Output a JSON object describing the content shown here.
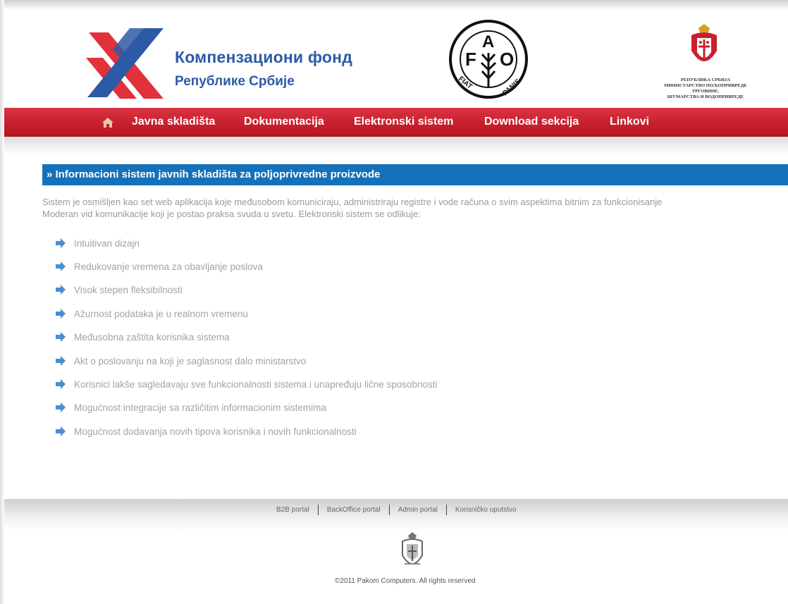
{
  "header": {
    "title": "Компензациони фонд",
    "subtitle": "Републике Србије",
    "ministry_lines": [
      "РЕПУБЛИКА СРБИЈА",
      "МИНИСТАРСТВО ПОЉОПРИВРЕДЕ",
      "ТРГОВИНЕ,",
      "ШУМАРСТВА И ВОДОПРИВРЕДЕ"
    ]
  },
  "nav": {
    "items": [
      "Javna skladišta",
      "Dokumentacija",
      "Elektronski sistem",
      "Download sekcija",
      "Linkovi"
    ]
  },
  "main": {
    "section_title": "» Informacioni sistem javnih skladišta za poljoprivredne proizvode",
    "intro_lines": [
      "Sistem je osmišljen kao set web aplikacija koje međusobom komuniciraju, administriraju registre i vode računa o svim aspektima bitnim za funkcionisanje",
      "Moderan vid komunikacije koji je postao praksa svuda u svetu. Elektronski sistem se odlikuje:"
    ],
    "features": [
      "Intuitivan dizajn",
      "Redukovanje vremena za obavljanje poslova",
      "Visok stepen fleksibilnosti",
      "Ažurnost podataka je u realnom vremenu",
      "Međusobna zaštita korisnika sistema",
      "Akt o poslovanju na koji je saglasnost dalo ministarstvo",
      "Korisnici lakše sagledavaju sve funkcionalnosti sistema i unapređuju lične sposobnosti",
      "Mogućnost integracije sa različitim informacionim sistemima",
      "Mogućnost dodavanja novih tipova korisnika i novih funkcionalnosti"
    ]
  },
  "footer": {
    "links": [
      "B2B portal",
      "BackOffice portal",
      "Admin portal",
      "Korisničko uputstvo"
    ],
    "copyright": "©2011 Pakom Computers. All rights reserved"
  },
  "icons": {
    "home": "home-icon",
    "bullet": "arrow-right-icon"
  },
  "colors": {
    "nav_red": "#c8202e",
    "section_blue": "#1571b9",
    "logo_blue": "#2d5aa7",
    "logo_red": "#e0313c"
  }
}
